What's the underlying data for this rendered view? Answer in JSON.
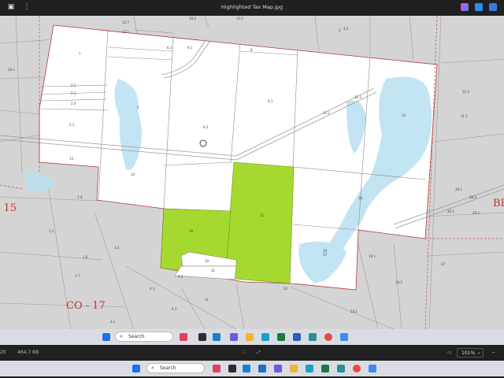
{
  "window": {
    "title": "Highlighted Tax Map.jpg",
    "left_icons": [
      "image-icon",
      "more-icon"
    ],
    "right_icons": [
      "copilot-icon",
      "edit-icon",
      "share-icon",
      "minimize-icon",
      "maximize-icon",
      "close-icon"
    ]
  },
  "map": {
    "labels": {
      "co15": "- 15",
      "co17": "CO - 17",
      "br": "BR"
    },
    "parcel_numbers": [
      "7",
      "6.3",
      "6.1",
      "6",
      "9.1",
      "11.3",
      "12",
      "11.2",
      "6.2",
      "2.2",
      "2.3",
      "2.4",
      "2.1",
      "13",
      "14",
      "15",
      "16",
      "17",
      "18",
      "19",
      "20",
      "21",
      "22",
      "1.4",
      "1.1",
      "1.6",
      "3.2",
      "3.1",
      "4.1",
      "4.2",
      "4.3",
      "11",
      "16.1",
      "10.1",
      "14.2",
      "27",
      "21.1",
      "11.5",
      "29.1",
      "3",
      "5",
      "4.5",
      "12.7",
      "12.1",
      "13.3",
      "10.2",
      "1.7",
      "28.1",
      "26.1",
      "26.2",
      "28.3"
    ],
    "colors": {
      "background": "#d4d4d4",
      "parcel_fill": "#ffffff",
      "highlight": "#a6d930",
      "boundary": "#b8393a",
      "water": "#b8dff0",
      "red_text": "#c9312b"
    }
  },
  "taskbar": {
    "search_placeholder": "Search"
  },
  "statusbar": {
    "size_text": "464.7 KB",
    "left_cut": "20",
    "zoom": "101%"
  },
  "outer_taskbar": {
    "search_placeholder": "Search"
  }
}
